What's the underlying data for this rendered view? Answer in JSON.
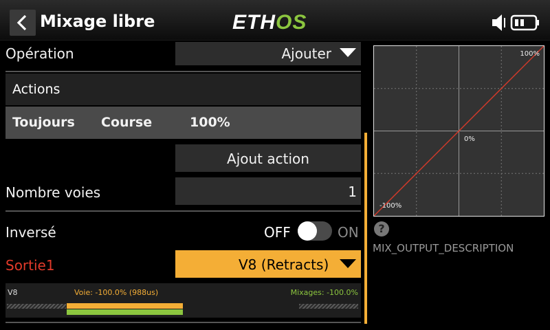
{
  "header": {
    "title": "Mixage libre",
    "logo": {
      "part1": "ETH",
      "part2": "OS"
    },
    "logo_colors": {
      "eth": "#ffffff",
      "os": "#8cc63f"
    },
    "icons": [
      "back-arrow-icon",
      "speaker-muted-icon",
      "battery-icon"
    ]
  },
  "form": {
    "operation": {
      "label": "Opération",
      "value": "Ajouter"
    },
    "actions": {
      "header": "Actions",
      "row": {
        "condition": "Toujours",
        "type": "Course",
        "value": "100%"
      },
      "add_button": "Ajout action"
    },
    "channels": {
      "label": "Nombre voies",
      "value": "1"
    },
    "reverse": {
      "label": "Inversé",
      "off": "OFF",
      "on": "ON",
      "state": "OFF"
    },
    "output": {
      "label": "Sortie1",
      "value": "V8 (Retracts)"
    }
  },
  "monitor": {
    "channel": "V8",
    "voie": "Voie: -100.0% (988us)",
    "mixages": "Mixages: -100.0%",
    "voie_color": "#f4ae36",
    "mixages_color": "#8cc63f"
  },
  "curve": {
    "label_max": "100%",
    "label_mid": "0%",
    "label_min": "-100%",
    "line_color": "#d23a2a"
  },
  "help": {
    "icon": "?",
    "description": "MIX_OUTPUT_DESCRIPTION"
  },
  "colors": {
    "accent": "#f4ae36",
    "warning_label": "#e23a2a"
  }
}
